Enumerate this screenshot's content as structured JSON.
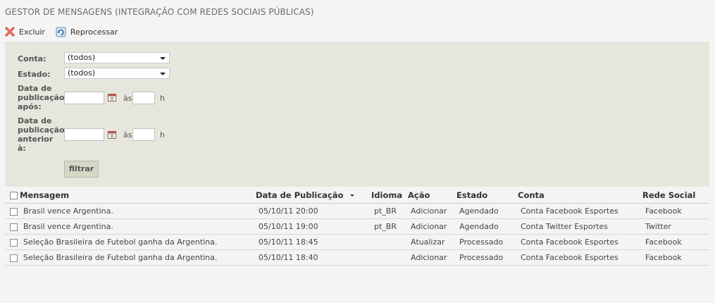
{
  "page": {
    "title": "GESTOR DE MENSAGENS (INTEGRAÇÃO COM REDES SOCIAIS PÚBLICAS)"
  },
  "toolbar": {
    "delete_label": "Excluir",
    "reprocess_label": "Reprocessar",
    "delete_icon": "delete-x-icon",
    "reprocess_icon": "reprocess-icon"
  },
  "filters": {
    "account_label": "Conta:",
    "account_value": "(todos)",
    "state_label": "Estado:",
    "state_value": "(todos)",
    "date_after_label": [
      "Data de",
      "publicação",
      "após:"
    ],
    "date_before_label": [
      "Data de",
      "publicação",
      "anterior",
      "à:"
    ],
    "at_label": "às",
    "hour_label": "h",
    "filter_button": "filtrar",
    "date_after_value": "",
    "hour_after_value": "",
    "date_before_value": "",
    "hour_before_value": ""
  },
  "table": {
    "headers": {
      "message": "Mensagem",
      "date": "Data de Publicação",
      "language": "Idioma",
      "action": "Ação",
      "state": "Estado",
      "account": "Conta",
      "network": "Rede Social"
    },
    "rows": [
      {
        "message": "Brasil vence Argentina.",
        "date": "05/10/11 20:00",
        "language": "pt_BR",
        "action": "Adicionar",
        "state": "Agendado",
        "account": "Conta Facebook Esportes",
        "network": "Facebook"
      },
      {
        "message": "Brasil vence Argentina.",
        "date": "05/10/11 19:00",
        "language": "pt_BR",
        "action": "Adicionar",
        "state": "Agendado",
        "account": "Conta Twitter Esportes",
        "network": "Twitter"
      },
      {
        "message": "Seleção Brasileira de Futebol ganha da Argentina.",
        "date": "05/10/11 18:45",
        "language": "",
        "action": "Atualizar",
        "state": "Processado",
        "account": "Conta Facebook Esportes",
        "network": "Facebook"
      },
      {
        "message": "Seleção Brasileira de Futebol ganha da Argentina.",
        "date": "05/10/11 18:40",
        "language": "",
        "action": "Adicionar",
        "state": "Processado",
        "account": "Conta Facebook Esportes",
        "network": "Facebook"
      }
    ]
  }
}
